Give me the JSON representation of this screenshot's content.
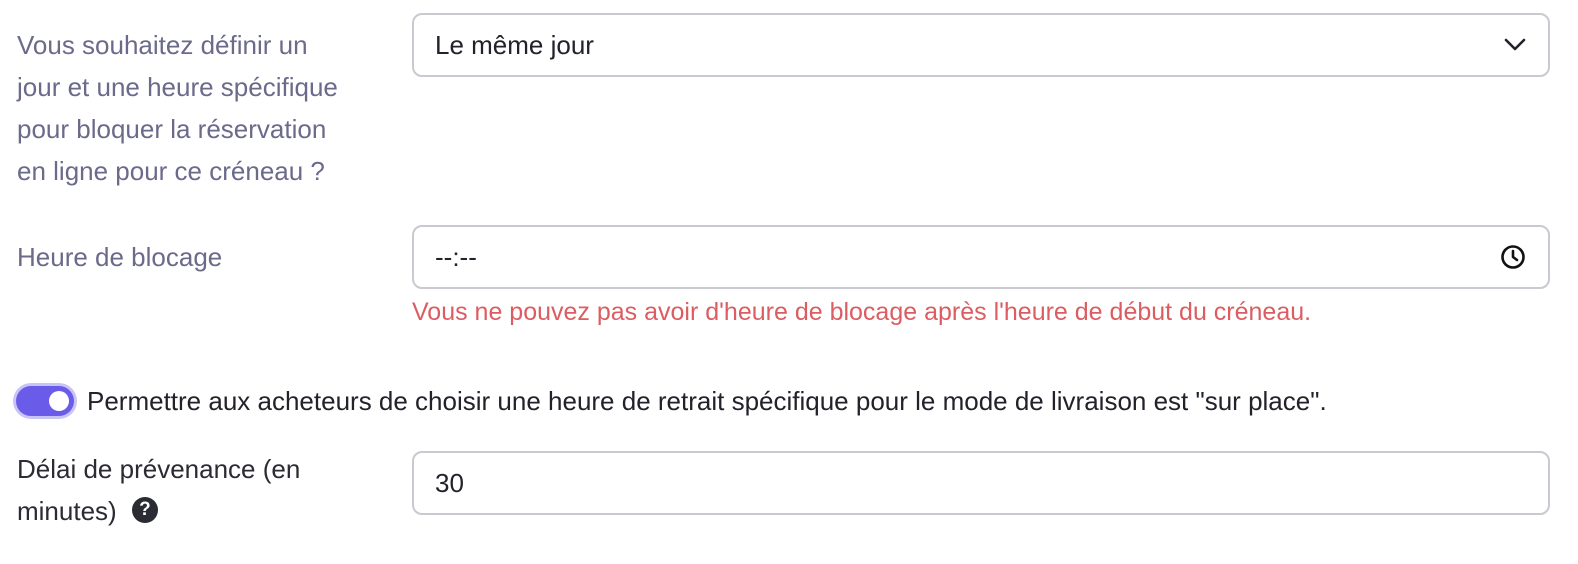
{
  "block_day": {
    "label_lines": [
      "Vous souhaitez définir un",
      "jour et une heure spécifique",
      "pour bloquer la réservation",
      "en ligne pour ce créneau ?"
    ],
    "selected": "Le même jour",
    "icon": "chevron-down-icon"
  },
  "block_time": {
    "label": "Heure de blocage",
    "value": "--:--",
    "icon": "clock-icon",
    "error": "Vous ne pouvez pas avoir d'heure de blocage après l'heure de début du créneau."
  },
  "pickup_toggle": {
    "checked": true,
    "label": "Permettre aux acheteurs de choisir une heure de retrait spécifique pour le mode de livraison est \"sur place\"."
  },
  "notice_delay": {
    "label_lines": [
      "Délai de prévenance (en",
      "minutes)"
    ],
    "help_icon": "question-circle-icon",
    "help_glyph": "?",
    "value": "30"
  },
  "colors": {
    "label": "#6b6a8b",
    "error": "#dc5d61",
    "accent": "#6a5ce8",
    "border": "#c9c9cf"
  }
}
